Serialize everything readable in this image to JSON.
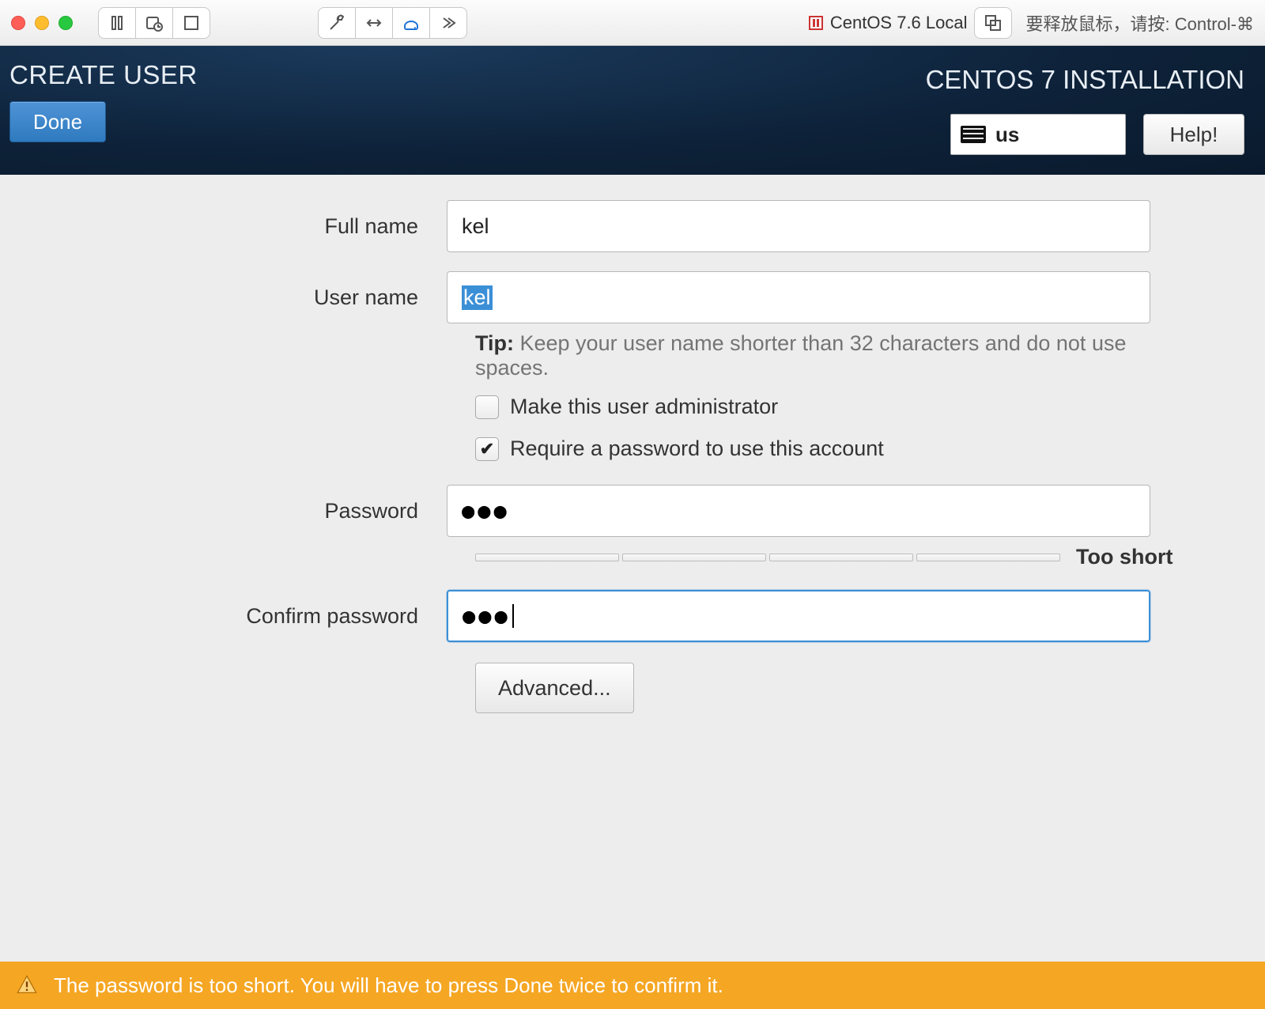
{
  "mac": {
    "title": "CentOS 7.6 Local",
    "release_hint": "要释放鼠标，请按: Control-⌘"
  },
  "header": {
    "page_title": "CREATE USER",
    "done_label": "Done",
    "install_title": "CENTOS 7 INSTALLATION",
    "kbd_layout": "us",
    "help_label": "Help!"
  },
  "form": {
    "fullname_label": "Full name",
    "fullname_value": "kel",
    "username_label": "User name",
    "username_value": "kel",
    "tip_prefix": "Tip:",
    "tip_text": " Keep your user name shorter than 32 characters and do not use spaces.",
    "admin_checkbox_label": "Make this user administrator",
    "admin_checked": false,
    "require_pw_label": "Require a password to use this account",
    "require_pw_checked": true,
    "password_label": "Password",
    "password_value": "●●●",
    "strength_label": "Too short",
    "confirm_label": "Confirm password",
    "confirm_value": "●●●",
    "advanced_label": "Advanced..."
  },
  "warning": {
    "text": "The password is too short. You will have to press Done twice to confirm it."
  }
}
